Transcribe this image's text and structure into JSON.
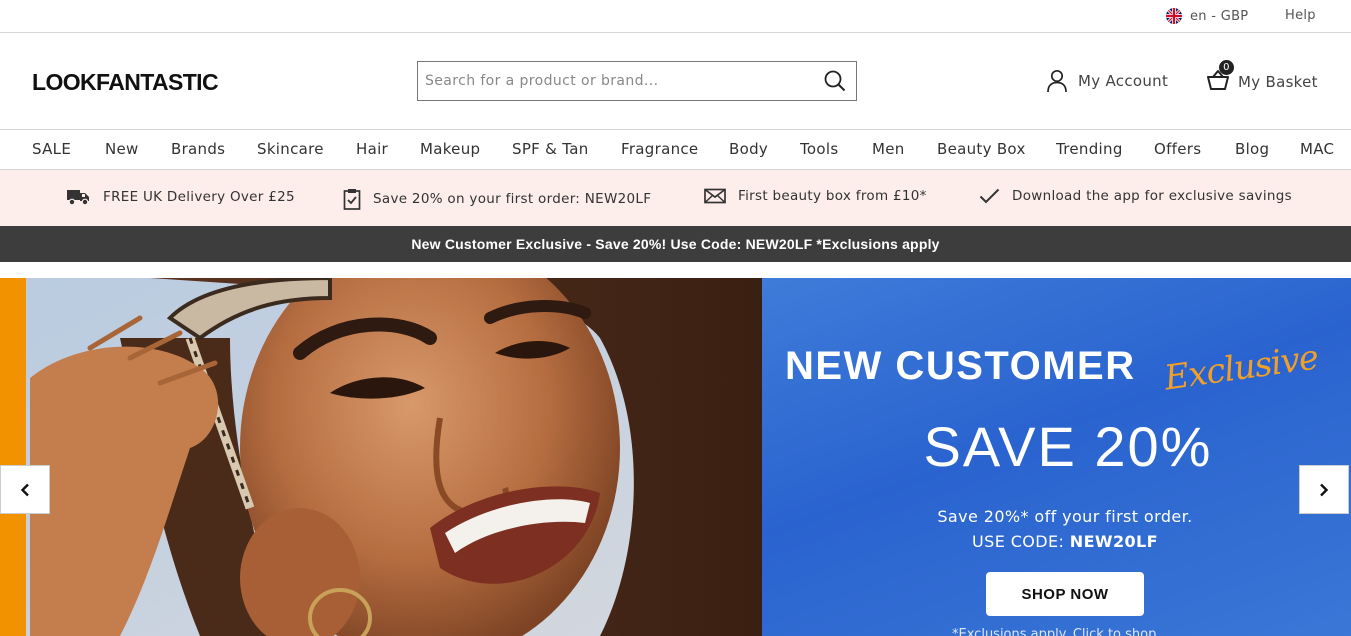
{
  "utility": {
    "locale": "en - GBP",
    "help": "Help"
  },
  "header": {
    "logo": "LOOKFANTASTIC",
    "search_placeholder": "Search for a product or brand...",
    "account": "My Account",
    "basket": "My Basket",
    "basket_count": "0"
  },
  "nav": {
    "items": [
      "SALE",
      "New",
      "Brands",
      "Skincare",
      "Hair",
      "Makeup",
      "SPF & Tan",
      "Fragrance",
      "Body",
      "Tools",
      "Men",
      "Beauty Box",
      "Trending",
      "Offers",
      "Blog",
      "MAC"
    ]
  },
  "usp": [
    {
      "icon": "truck-icon",
      "text": "FREE UK Delivery Over £25"
    },
    {
      "icon": "clipboard-check-icon",
      "text": "Save 20% on your first order: NEW20LF"
    },
    {
      "icon": "envelope-icon",
      "text": "First beauty box from £10*"
    },
    {
      "icon": "checkmark-icon",
      "text": "Download the app for exclusive savings"
    }
  ],
  "promo_strip": "New Customer Exclusive - Save 20%! Use Code: NEW20LF *Exclusions apply",
  "hero": {
    "headline": "NEW CUSTOMER",
    "script": "Exclusive",
    "save": "SAVE 20%",
    "sub_line1": "Save 20%* off your first order.",
    "sub_line2_prefix": "USE CODE: ",
    "code": "NEW20LF",
    "button": "SHOP NOW",
    "fine_print": "*Exclusions apply. Click to shop",
    "panel_color": "#2a63cf",
    "script_color": "#f0a028"
  },
  "colors": {
    "usp_bg": "#fdeeec",
    "promo_bg": "#3d3d3d",
    "accent_orange": "#f39200"
  }
}
